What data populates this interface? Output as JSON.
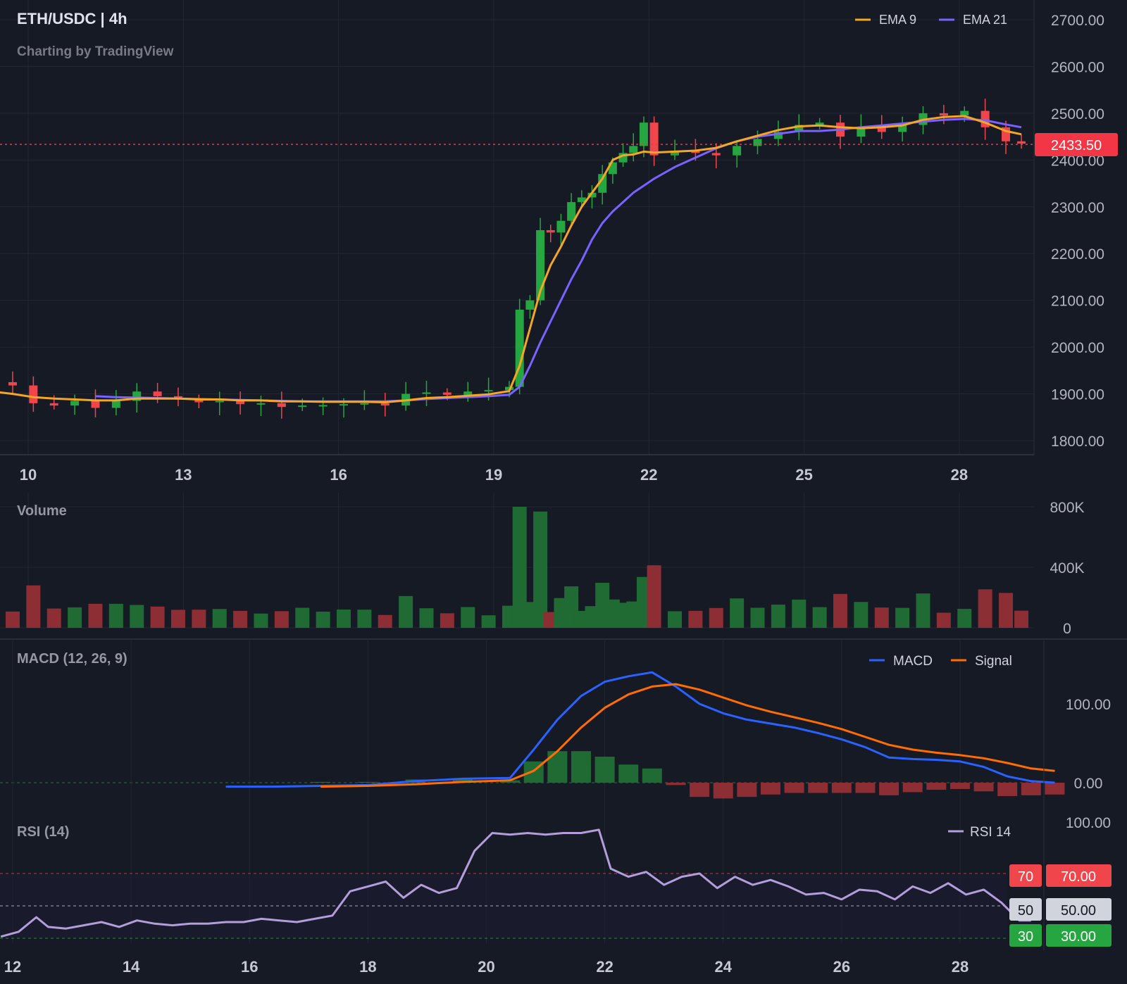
{
  "header": {
    "symbol": "ETH/USDC | 4h",
    "credit": "Charting by TradingView"
  },
  "colors": {
    "background": "#161a25",
    "up": "#26a641",
    "down": "#f0464b",
    "ema9": "#f5a623",
    "ema21": "#7b61ff",
    "macd": "#2962ff",
    "signal": "#ff6d00",
    "rsi": "#b39ddb",
    "price_tag": "#f23645"
  },
  "price_panel": {
    "legend": [
      {
        "name": "EMA 9",
        "color": "#f5a623"
      },
      {
        "name": "EMA 21",
        "color": "#7b61ff"
      }
    ],
    "y_ticks": [
      "2700.00",
      "2600.00",
      "2500.00",
      "2400.00",
      "2300.00",
      "2200.00",
      "2100.00",
      "2000.00",
      "1900.00",
      "1800.00"
    ],
    "current_price": "2433.50",
    "x_ticks": [
      "10",
      "13",
      "16",
      "19",
      "22",
      "25",
      "28"
    ]
  },
  "volume_panel": {
    "title": "Volume",
    "y_ticks": [
      "800K",
      "400K",
      "0"
    ]
  },
  "macd_panel": {
    "title": "MACD (12, 26, 9)",
    "legend": [
      {
        "name": "MACD",
        "color": "#2962ff"
      },
      {
        "name": "Signal",
        "color": "#ff6d00"
      }
    ],
    "y_ticks": [
      "100.00",
      "0.00"
    ]
  },
  "rsi_panel": {
    "title": "RSI (14)",
    "legend": [
      {
        "name": "RSI 14",
        "color": "#b39ddb"
      }
    ],
    "y_top": "100.00",
    "levels": [
      {
        "level": "70",
        "tag": "70.00",
        "color": "#f0464b"
      },
      {
        "level": "50",
        "tag": "50.00",
        "color": "#d1d4dc"
      },
      {
        "level": "30",
        "tag": "30.00",
        "color": "#26a641"
      }
    ],
    "x_ticks": [
      "12",
      "14",
      "16",
      "18",
      "20",
      "22",
      "24",
      "26",
      "28"
    ]
  },
  "chart_data": {
    "type": "candlestick",
    "price_ylim": [
      1800,
      2700
    ],
    "price_series": {
      "day": [
        9.3,
        9.7,
        10.1,
        10.5,
        10.9,
        11.3,
        11.7,
        12.1,
        12.5,
        12.9,
        13.3,
        13.7,
        14.1,
        14.5,
        14.9,
        15.3,
        15.7,
        16.1,
        16.5,
        16.9,
        17.3,
        17.7,
        18.1,
        18.5,
        18.9,
        19.3,
        19.5,
        19.7,
        19.9,
        20.1,
        20.3,
        20.5,
        20.7,
        20.9,
        21.1,
        21.3,
        21.5,
        21.7,
        21.9,
        22.1,
        22.5,
        22.9,
        23.3,
        23.7,
        24.1,
        24.5,
        24.9,
        25.3,
        25.7,
        26.1,
        26.5,
        26.9,
        27.3,
        27.7,
        28.1,
        28.5,
        28.9,
        29.2
      ],
      "close": [
        1925,
        1918,
        1880,
        1875,
        1885,
        1870,
        1885,
        1905,
        1895,
        1890,
        1882,
        1885,
        1878,
        1880,
        1872,
        1875,
        1876,
        1878,
        1880,
        1875,
        1900,
        1903,
        1898,
        1905,
        1908,
        1915,
        2080,
        2100,
        2250,
        2245,
        2270,
        2310,
        2320,
        2330,
        2370,
        2395,
        2415,
        2430,
        2480,
        2410,
        2420,
        2415,
        2410,
        2430,
        2445,
        2460,
        2475,
        2480,
        2450,
        2470,
        2460,
        2475,
        2500,
        2495,
        2505,
        2470,
        2440,
        2435
      ],
      "ema9": [
        1905,
        1900,
        1893,
        1890,
        1888,
        1886,
        1886,
        1890,
        1890,
        1890,
        1888,
        1888,
        1886,
        1886,
        1884,
        1884,
        1883,
        1883,
        1883,
        1882,
        1886,
        1891,
        1893,
        1896,
        1899,
        1906,
        1960,
        2040,
        2120,
        2175,
        2215,
        2260,
        2300,
        2330,
        2360,
        2400,
        2410,
        2412,
        2418,
        2416,
        2418,
        2420,
        2426,
        2440,
        2452,
        2464,
        2472,
        2474,
        2470,
        2468,
        2470,
        2474,
        2486,
        2492,
        2494,
        2480,
        2462,
        2455
      ],
      "ema21": [
        null,
        null,
        null,
        null,
        null,
        1895,
        1893,
        1892,
        1891,
        1890,
        1889,
        1888,
        1887,
        1886,
        1885,
        1884,
        1884,
        1884,
        1884,
        1884,
        1886,
        1889,
        1891,
        1893,
        1895,
        1898,
        1915,
        1960,
        2010,
        2055,
        2100,
        2145,
        2185,
        2230,
        2265,
        2290,
        2310,
        2330,
        2345,
        2360,
        2385,
        2405,
        2425,
        2440,
        2450,
        2456,
        2462,
        2462,
        2465,
        2470,
        2474,
        2478,
        2482,
        2486,
        2488,
        2485,
        2476,
        2470
      ]
    },
    "volume_ylim": [
      0,
      800000
    ],
    "macd_ylim": [
      -50,
      150
    ],
    "macd_series": {
      "day": [
        15.6,
        16.4,
        17.2,
        18.0,
        18.8,
        19.6,
        20.4,
        20.8,
        21.2,
        21.6,
        22.0,
        22.4,
        22.8,
        23.2,
        23.6,
        24.0,
        24.4,
        24.8,
        25.2,
        25.6,
        26.0,
        26.4,
        26.8,
        27.2,
        27.6,
        28.0,
        28.4,
        28.8,
        29.2,
        29.6
      ],
      "macd": [
        -5,
        -5,
        -4,
        -3,
        2,
        5,
        6,
        42,
        80,
        110,
        128,
        135,
        140,
        122,
        100,
        88,
        80,
        75,
        70,
        63,
        55,
        45,
        32,
        30,
        29,
        27,
        20,
        8,
        2,
        0
      ],
      "signal": [
        null,
        null,
        -5,
        -4,
        -2,
        1,
        3,
        15,
        40,
        70,
        95,
        112,
        122,
        125,
        118,
        108,
        98,
        90,
        83,
        76,
        68,
        58,
        48,
        42,
        38,
        35,
        31,
        25,
        18,
        15
      ],
      "hist": [
        0,
        0,
        1,
        1,
        4,
        4,
        3,
        27,
        40,
        40,
        33,
        23,
        18,
        -3,
        -18,
        -20,
        -18,
        -15,
        -13,
        -13,
        -13,
        -13,
        -16,
        -12,
        -9,
        -8,
        -11,
        -17,
        -16,
        -15
      ]
    },
    "rsi_ylim": [
      20,
      100
    ],
    "rsi_series": {
      "day": [
        11.8,
        12.1,
        12.4,
        12.6,
        12.9,
        13.2,
        13.5,
        13.8,
        14.1,
        14.4,
        14.7,
        15.0,
        15.3,
        15.6,
        15.9,
        16.2,
        16.5,
        16.8,
        17.1,
        17.4,
        17.7,
        18.0,
        18.3,
        18.6,
        18.9,
        19.2,
        19.5,
        19.8,
        20.1,
        20.4,
        20.7,
        21.0,
        21.3,
        21.6,
        21.9,
        22.1,
        22.4,
        22.7,
        23.0,
        23.3,
        23.6,
        23.9,
        24.2,
        24.5,
        24.8,
        25.1,
        25.4,
        25.7,
        26.0,
        26.3,
        26.6,
        26.9,
        27.2,
        27.5,
        27.8,
        28.1,
        28.4,
        28.7,
        29.0,
        29.2
      ],
      "rsi": [
        31,
        34,
        43,
        37,
        36,
        38,
        40,
        37,
        41,
        39,
        38,
        39,
        39,
        40,
        40,
        42,
        41,
        40,
        42,
        44,
        59,
        62,
        65,
        55,
        63,
        58,
        61,
        84,
        95,
        94,
        95,
        94,
        95,
        95,
        97,
        73,
        68,
        71,
        63,
        68,
        70,
        61,
        68,
        63,
        66,
        62,
        57,
        58,
        54,
        60,
        59,
        54,
        62,
        58,
        64,
        57,
        60,
        52,
        41,
        41
      ]
    }
  }
}
